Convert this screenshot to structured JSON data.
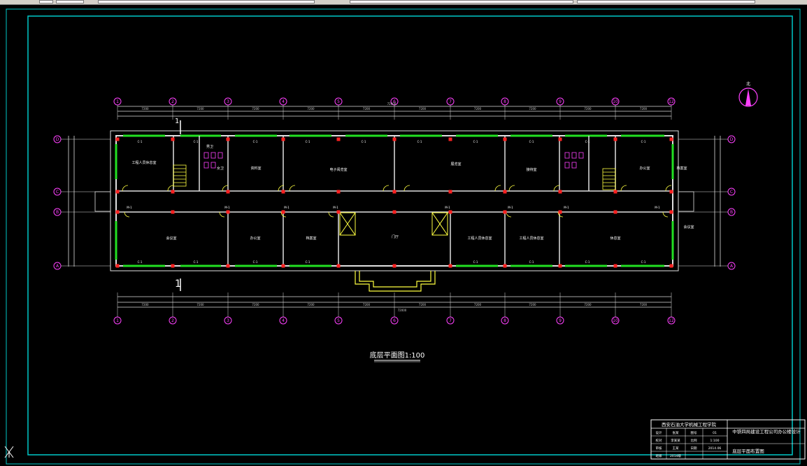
{
  "app": {
    "name": "CAD drawing viewer"
  },
  "colors": {
    "background": "#000000",
    "frame": "#00c8c8",
    "axis": "#ff40ff",
    "wall": "#e0e0e0",
    "window": "#22e022",
    "door": "#ffff40",
    "column": "#ff2020",
    "dimension": "#dddddd",
    "text": "#ffffff"
  },
  "drawing": {
    "title": "底层平面图1:100",
    "section_marker": "1",
    "axis_labels_columns": [
      "1",
      "2",
      "3",
      "4",
      "5",
      "6",
      "7",
      "8",
      "9",
      "10",
      "11",
      "12"
    ],
    "axis_labels_rows": [
      "D",
      "C",
      "B",
      "A"
    ],
    "room_labels": [
      "工程人员休息室",
      "男卫",
      "女卫",
      "资料室",
      "电子阅览室",
      "展览室",
      "接待室",
      "会议室",
      "办公室",
      "档案室",
      "门厅",
      "工程人员休息室",
      "工程人员休息室",
      "休息室",
      "办公室",
      "档案室",
      "会议室"
    ],
    "dimension_totals": [
      "72000",
      "72000"
    ],
    "bay_dimension": "7200",
    "window_tag": "C-1",
    "door_tag": "M-1"
  },
  "title_block": {
    "school": "西安石油大学机械工程学院",
    "project": "中铁四局建设工程公司办公楼设计",
    "sheet_title": "底层平面布置图",
    "row_labels": [
      "设计",
      "校对",
      "审核",
      "班级"
    ],
    "row_values": [
      "张某",
      "李某某",
      "王某",
      "2014级"
    ],
    "right_labels": [
      "图号",
      "比例",
      "日期"
    ],
    "right_values": [
      "01",
      "1:100",
      "2014.06"
    ]
  },
  "north_arrow": {
    "label": "北"
  }
}
